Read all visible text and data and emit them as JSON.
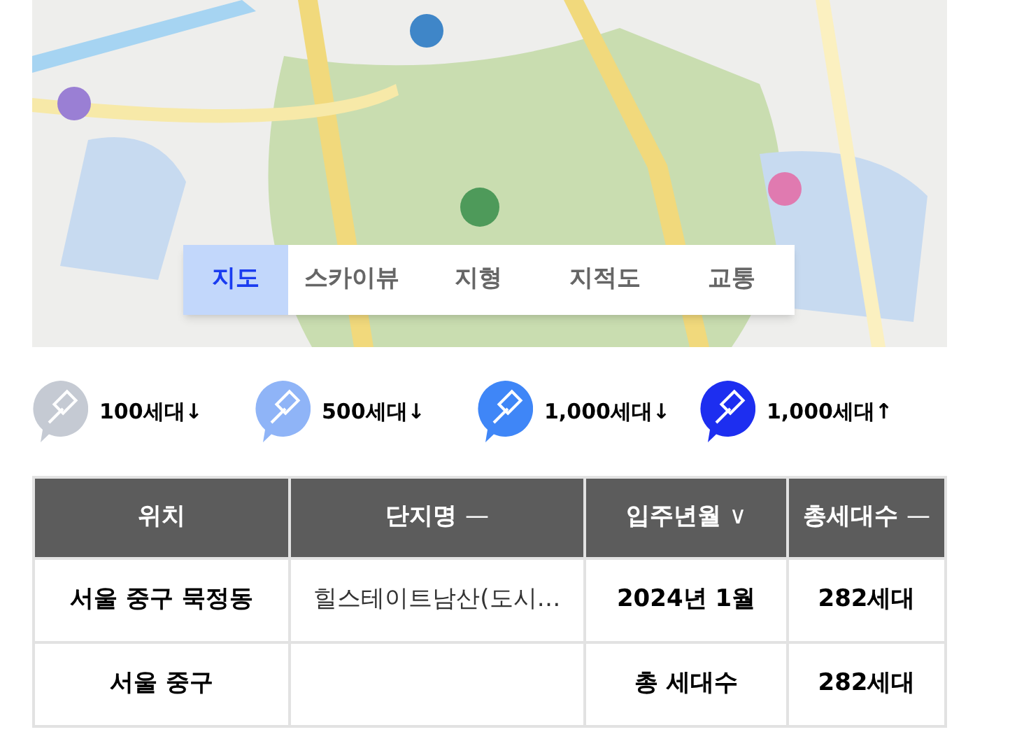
{
  "map": {
    "tabs": [
      {
        "label": "지도",
        "selected": true
      },
      {
        "label": "스카이뷰",
        "selected": false
      },
      {
        "label": "지형",
        "selected": false
      },
      {
        "label": "지적도",
        "selected": false
      },
      {
        "label": "교통",
        "selected": false
      }
    ]
  },
  "legend": [
    {
      "label": "100세대↓",
      "color": "#c5cad3"
    },
    {
      "label": "500세대↓",
      "color": "#8fb4f7"
    },
    {
      "label": "1,000세대↓",
      "color": "#3f86f7"
    },
    {
      "label": "1,000세대↑",
      "color": "#1d2ef0"
    }
  ],
  "table": {
    "columns": [
      {
        "label": "위치"
      },
      {
        "label": "단지명",
        "sort": "—"
      },
      {
        "label": "입주년월",
        "sort": "∨"
      },
      {
        "label": "총세대수",
        "sort": "—"
      }
    ],
    "rows": [
      {
        "kind": "item",
        "cells": [
          "서울 중구 묵정동",
          "힐스테이트남산(도시…",
          "2024년 1월",
          "282세대"
        ]
      },
      {
        "kind": "total",
        "cells": [
          "서울 중구",
          "",
          "총 세대수",
          "282세대"
        ]
      }
    ]
  }
}
